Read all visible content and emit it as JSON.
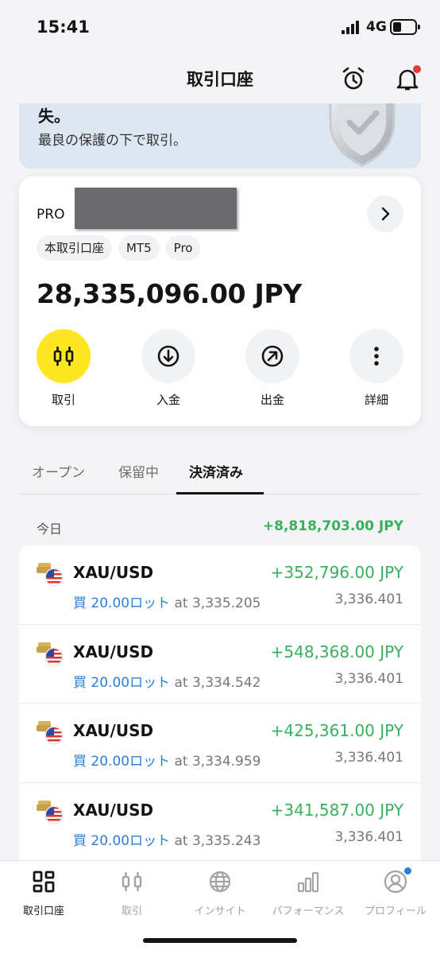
{
  "status_bar": {
    "time": "15:41",
    "network": "4G",
    "battery_level": 0.35
  },
  "header": {
    "title": "取引口座",
    "icons": [
      "alarm-clock-icon",
      "bell-icon"
    ]
  },
  "banner": {
    "line1": "失。",
    "line2": "最良の保護の下で取引。",
    "icon": "shield-icon"
  },
  "account": {
    "name": "PRO",
    "tags": [
      "本取引口座",
      "MT5",
      "Pro"
    ],
    "balance": "28,335,096.00 JPY",
    "actions": [
      {
        "label": "取引",
        "icon": "candlestick-icon"
      },
      {
        "label": "入金",
        "icon": "arrow-down-circle-icon"
      },
      {
        "label": "出金",
        "icon": "arrow-up-right-circle-icon"
      },
      {
        "label": "詳細",
        "icon": "more-vertical-icon"
      }
    ]
  },
  "tabs": [
    {
      "label": "オープン",
      "active": false
    },
    {
      "label": "保留中",
      "active": false
    },
    {
      "label": "決済済み",
      "active": true
    }
  ],
  "day_group": {
    "label": "今日",
    "total": "+8,818,703.00 JPY"
  },
  "trades": [
    {
      "symbol": "XAU/USD",
      "pl": "+352,796.00 JPY",
      "side_lot": "買 20.00ロット",
      "open": " at 3,335.205",
      "close": "3,336.401"
    },
    {
      "symbol": "XAU/USD",
      "pl": "+548,368.00 JPY",
      "side_lot": "買 20.00ロット",
      "open": " at 3,334.542",
      "close": "3,336.401"
    },
    {
      "symbol": "XAU/USD",
      "pl": "+425,361.00 JPY",
      "side_lot": "買 20.00ロット",
      "open": " at 3,334.959",
      "close": "3,336.401"
    },
    {
      "symbol": "XAU/USD",
      "pl": "+341,587.00 JPY",
      "side_lot": "買 20.00ロット",
      "open": " at 3,335.243",
      "close": "3,336.401"
    }
  ],
  "bottom_nav": [
    {
      "label": "取引口座",
      "icon": "grid-icon",
      "active": true
    },
    {
      "label": "取引",
      "icon": "candlestick-icon",
      "active": false
    },
    {
      "label": "インサイト",
      "icon": "globe-icon",
      "active": false
    },
    {
      "label": "パフォーマンス",
      "icon": "bar-chart-icon",
      "active": false
    },
    {
      "label": "プロフィール",
      "icon": "profile-icon",
      "active": false
    }
  ],
  "colors": {
    "accent_yellow": "#fde722",
    "profit_green": "#3aaf5c",
    "buy_blue": "#2b7fd8",
    "notification_red": "#e53935"
  }
}
